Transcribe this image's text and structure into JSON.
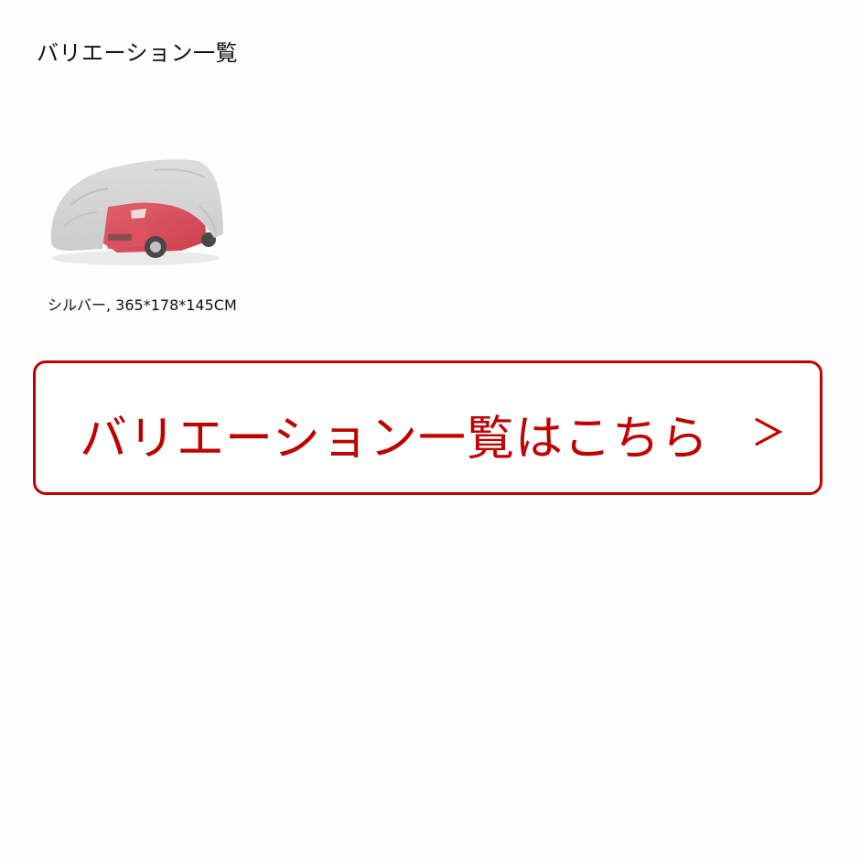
{
  "section": {
    "title": "バリエーション一覧"
  },
  "variants": [
    {
      "label": "シルバー, 365*178*145CM",
      "image": "covered-car-thumbnail"
    }
  ],
  "cta": {
    "label": "バリエーション一覧はこちら",
    "icon": "chevron-right-icon"
  },
  "colors": {
    "accent": "#c00000",
    "text": "#111111",
    "background": "#fdfefd"
  }
}
